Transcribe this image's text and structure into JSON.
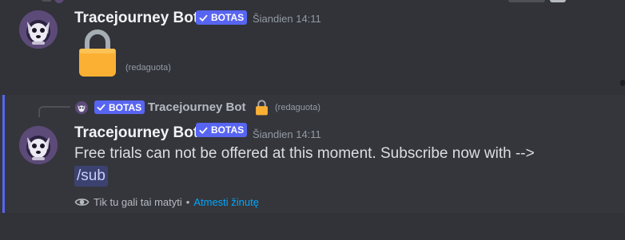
{
  "message1": {
    "username": "Tracejourney Bot",
    "bot_tag": "BOTAS",
    "timestamp": "Šiandien 14:11",
    "content_icon": "lock-emoji",
    "edited_label": "(redaguota)"
  },
  "message2": {
    "reply": {
      "bot_tag": "BOTAS",
      "username": "Tracejourney Bot",
      "content_icon": "lock-emoji",
      "edited_label": "(redaguota)"
    },
    "username": "Tracejourney Bot",
    "bot_tag": "BOTAS",
    "timestamp": "Šiandien 14:11",
    "text": "Free trials can not be offered at this moment. Subscribe now with -->",
    "command": "/sub",
    "ephemeral_note": "Tik tu gali tai matyti",
    "separator": "•",
    "dismiss_label": "Atmesti žinutę"
  },
  "colors": {
    "background": "#313338",
    "highlight": "#35363c",
    "accent": "#5865f2",
    "link": "#00a8fc",
    "lock": "#fbb034"
  }
}
